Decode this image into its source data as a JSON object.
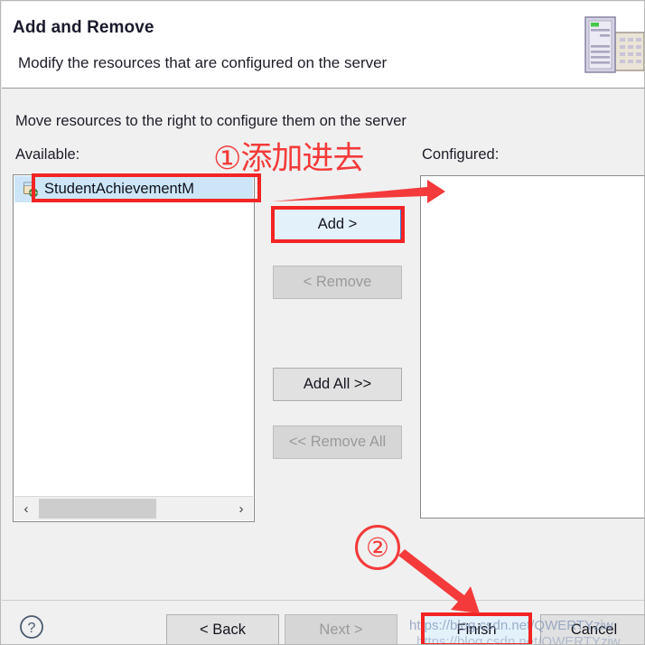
{
  "window": {
    "title": "Add and Remove",
    "subtitle": "Modify the resources that are configured on the server",
    "banner_icon": "server-tower-icon"
  },
  "body": {
    "instruction": "Move resources to the right to configure them on the server",
    "available_label": "Available:",
    "configured_label": "Configured:",
    "available_items": [
      {
        "label": "StudentAchievementM",
        "icon": "web-module-icon",
        "selected": true
      }
    ],
    "configured_items": [],
    "scrollbar": {
      "left_arrow": "‹",
      "right_arrow": "›"
    }
  },
  "transfer_buttons": [
    {
      "name": "add",
      "label": "Add >",
      "state": "focused"
    },
    {
      "name": "remove",
      "label": "< Remove",
      "state": "disabled"
    },
    {
      "name": "add-all",
      "label": "Add All >>",
      "state": "enabled"
    },
    {
      "name": "remove-all",
      "label": "<< Remove All",
      "state": "disabled"
    }
  ],
  "footer": {
    "help_icon": "question-mark-icon",
    "buttons": [
      {
        "name": "back",
        "label": "< Back",
        "state": "enabled"
      },
      {
        "name": "next",
        "label": "Next >",
        "state": "disabled"
      },
      {
        "name": "finish",
        "label": "Finish",
        "state": "focused"
      },
      {
        "name": "cancel",
        "label": "Cancel",
        "state": "enabled"
      }
    ]
  },
  "annotations": {
    "step_one_text": "①添加进去",
    "step_two_marker": "②",
    "highlight_color": "#f22424",
    "arrow_color": "#f43a3a"
  },
  "watermark": {
    "line1": "https://blog.csdn.net/QWERTYziw",
    "line2": "https://blog.csdn.net/QWERTYziw"
  }
}
